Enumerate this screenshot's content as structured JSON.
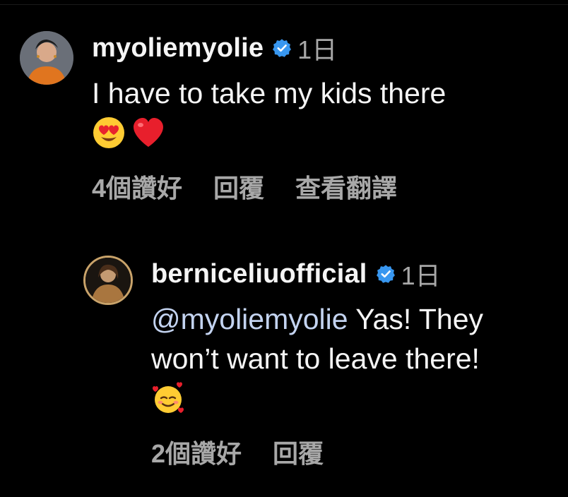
{
  "comments": [
    {
      "username": "myoliemyolie",
      "time": "1日",
      "text": "I have to take my kids there",
      "emoji": [
        "smiling-face-with-heart-eyes",
        "red-heart"
      ],
      "actions": {
        "likes": "4個讚好",
        "reply": "回覆",
        "translate": "查看翻譯"
      }
    },
    {
      "username": "berniceliuofficial",
      "time": "1日",
      "mention": "@myoliemyolie",
      "text_line1": " Yas! They",
      "text_line2": "won’t want to leave there!",
      "emoji": [
        "smiling-face-with-hearts"
      ],
      "actions": {
        "likes": "2個讚好",
        "reply": "回覆"
      }
    }
  ],
  "colors": {
    "background": "#000000",
    "primary_text": "#f5f5f5",
    "secondary_text": "#a8a8a8",
    "verified_blue": "#3897f0",
    "mention": "#c3d3f0"
  }
}
